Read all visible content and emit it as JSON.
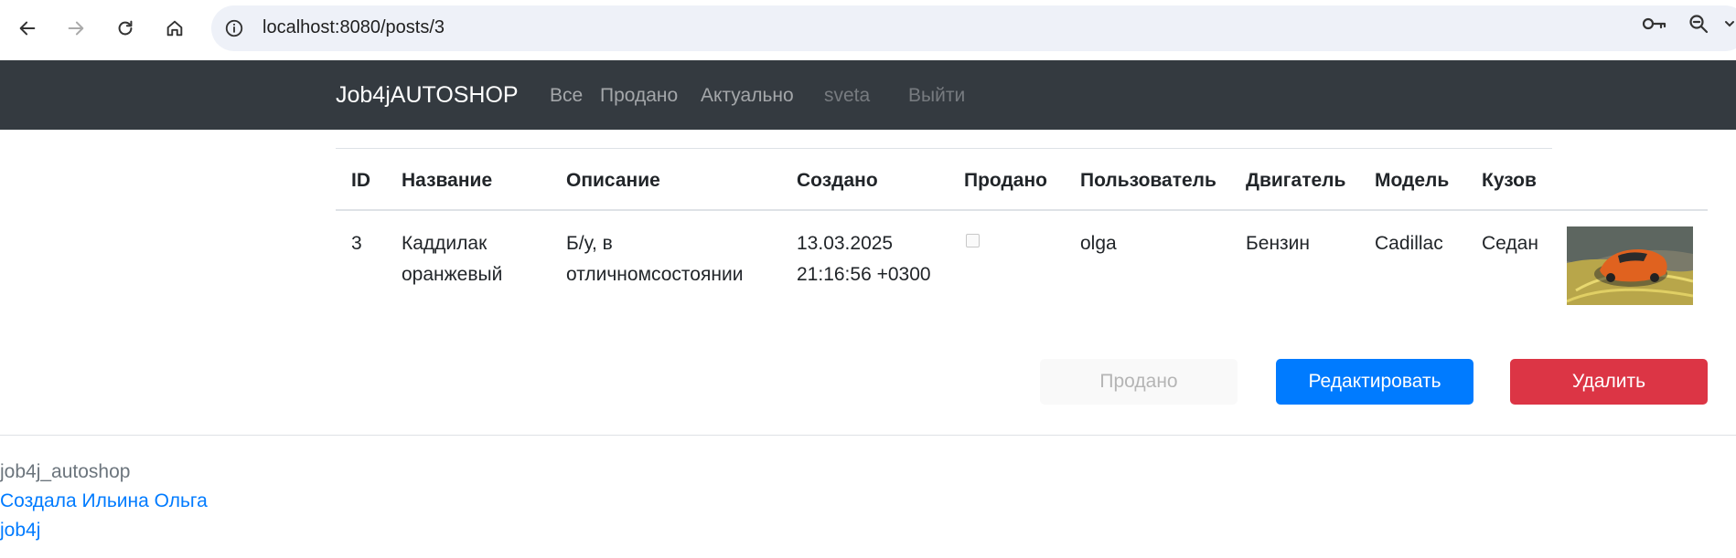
{
  "browser": {
    "url": "localhost:8080/posts/3"
  },
  "navbar": {
    "brand": "Job4jAUTOSHOP",
    "links": [
      "Все",
      "Продано",
      "Актуально"
    ],
    "user": "sveta",
    "logout": "Выйти"
  },
  "table": {
    "headers": [
      "ID",
      "Название",
      "Описание",
      "Создано",
      "Продано",
      "Пользователь",
      "Двигатель",
      "Модель",
      "Кузов"
    ],
    "row": {
      "id": "3",
      "name_line1": "Каддилак",
      "name_line2": "оранжевый",
      "description_line1": "Б/у, в",
      "description_line2": "отличномсостоянии",
      "created_line1": "13.03.2025",
      "created_line2": "21:16:56 +0300",
      "sold": false,
      "user": "olga",
      "engine": "Бензин",
      "model": "Cadillac",
      "body": "Седан",
      "image": "orange-car-photo"
    }
  },
  "actions": {
    "sold": "Продано",
    "edit": "Редактировать",
    "delete": "Удалить"
  },
  "footer": {
    "project": "job4j_autoshop",
    "author": "Создала Ильина Ольга",
    "site": "job4j"
  },
  "colors": {
    "navbar": "#343a40",
    "primary": "#007bff",
    "danger": "#dc3545"
  }
}
